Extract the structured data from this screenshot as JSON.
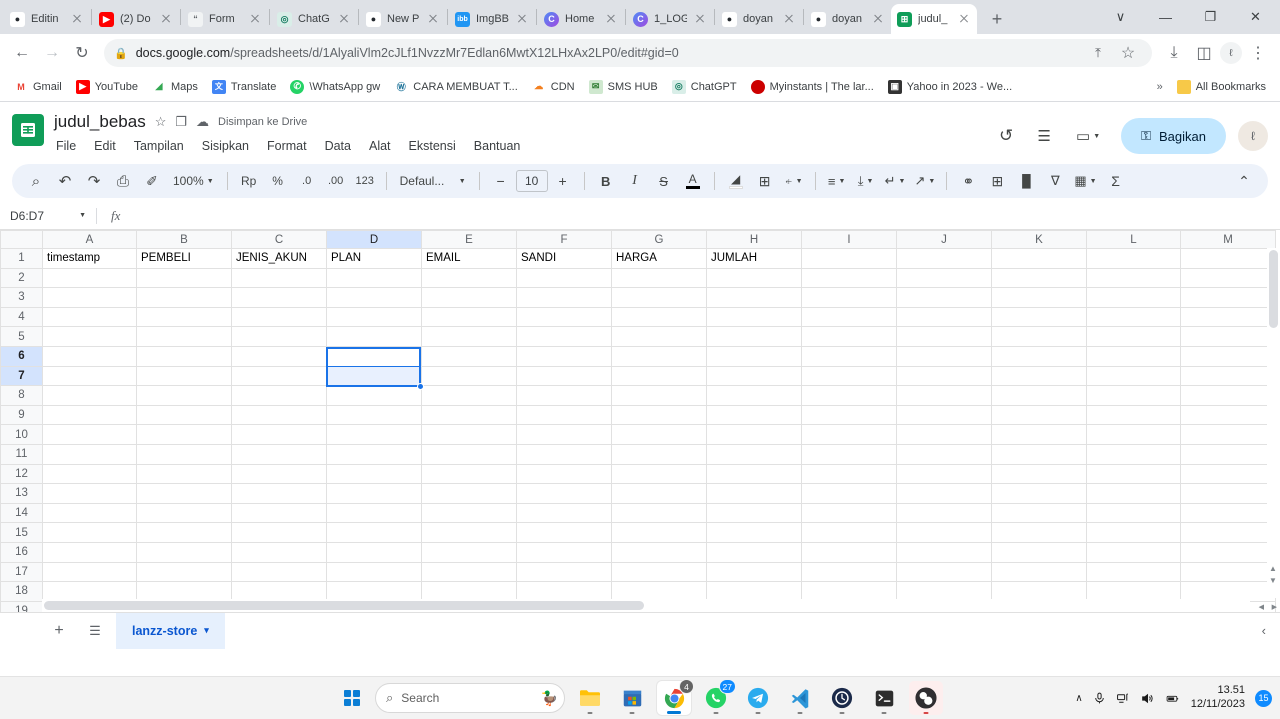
{
  "browser": {
    "tabs": [
      {
        "label": "Editin",
        "favicon": "github-icon",
        "fav_bg": "#ffffff",
        "fav_fg": "#24292e",
        "fav_text": "●",
        "active": false
      },
      {
        "label": "(2) Do",
        "favicon": "youtube-icon",
        "fav_bg": "#ff0000",
        "fav_fg": "#ffffff",
        "fav_text": "▶",
        "active": false
      },
      {
        "label": "Form",
        "favicon": "quote-icon",
        "fav_bg": "#f1f3f4",
        "fav_fg": "#5f6368",
        "fav_text": "“",
        "active": false
      },
      {
        "label": "ChatG",
        "favicon": "chatgpt-icon",
        "fav_bg": "#74aa9c",
        "fav_fg": "#ffffff",
        "fav_text": "◎",
        "active": false
      },
      {
        "label": "New P",
        "favicon": "github-icon",
        "fav_bg": "#ffffff",
        "fav_fg": "#24292e",
        "fav_text": "●",
        "active": false
      },
      {
        "label": "ImgBB",
        "favicon": "imgbb-icon",
        "fav_bg": "#2196f3",
        "fav_fg": "#ffffff",
        "fav_text": "ibb",
        "active": false
      },
      {
        "label": "Home",
        "favicon": "circle-gradient-icon",
        "fav_bg": "#7a3fd6",
        "fav_fg": "#ffffff",
        "fav_text": "C",
        "active": false
      },
      {
        "label": "1_LOG",
        "favicon": "circle-gradient-icon",
        "fav_bg": "#6a5acd",
        "fav_fg": "#ffffff",
        "fav_text": "C",
        "active": false
      },
      {
        "label": "doyan",
        "favicon": "github-icon",
        "fav_bg": "#ffffff",
        "fav_fg": "#24292e",
        "fav_text": "●",
        "active": false
      },
      {
        "label": "doyan",
        "favicon": "github-icon",
        "fav_bg": "#ffffff",
        "fav_fg": "#24292e",
        "fav_text": "●",
        "active": false
      },
      {
        "label": "judul_",
        "favicon": "sheets-icon",
        "fav_bg": "#0f9d58",
        "fav_fg": "#ffffff",
        "fav_text": "⊞",
        "active": true
      }
    ],
    "new_tab_label": "+",
    "window_controls": {
      "tab_search": "∨",
      "minimize": "—",
      "maximize": "❐",
      "close": "✕"
    },
    "nav": {
      "back": "←",
      "forward": "→",
      "reload": "↻"
    },
    "omnibox": {
      "lock_icon": "lock-icon",
      "host": "docs.google.com",
      "path": "/spreadsheets/d/1AlyaliVlm2cJLf1NvzzMr7Edlan6MwtX12LHxAx2LP0/edit#gid=0",
      "share_icon": "⤒",
      "star_icon": "☆",
      "download_icon": "⤓",
      "sidepanel_icon": "◫",
      "profile_icon": "ℓ",
      "menu_icon": "⋮"
    },
    "bookmarks": [
      {
        "label": "Gmail",
        "bg": "#ffffff",
        "fg": "#ea4335",
        "glyph": "M"
      },
      {
        "label": "YouTube",
        "bg": "#ff0000",
        "fg": "#ffffff",
        "glyph": "▶"
      },
      {
        "label": "Maps",
        "bg": "#ffffff",
        "fg": "#34a853",
        "glyph": "◢"
      },
      {
        "label": "Translate",
        "bg": "#4285f4",
        "fg": "#ffffff",
        "glyph": "文"
      },
      {
        "label": "\\WhatsApp gw",
        "bg": "#25d366",
        "fg": "#ffffff",
        "glyph": "✆"
      },
      {
        "label": "CARA MEMBUAT T...",
        "bg": "#ffffff",
        "fg": "#21759b",
        "glyph": "Ⓦ"
      },
      {
        "label": "CDN",
        "bg": "#ffffff",
        "fg": "#f38020",
        "glyph": "☁"
      },
      {
        "label": "SMS HUB",
        "bg": "#cfe8cf",
        "fg": "#2e7d32",
        "glyph": "✉"
      },
      {
        "label": "ChatGPT",
        "bg": "#ffffff",
        "fg": "#74aa9c",
        "glyph": "◎"
      },
      {
        "label": "Myinstants | The lar...",
        "bg": "#cc0000",
        "fg": "#ffffff",
        "glyph": "●"
      },
      {
        "label": "Yahoo in 2023 - We...",
        "bg": "#333333",
        "fg": "#ffffff",
        "glyph": "▣"
      }
    ],
    "overflow_label": "»",
    "all_bookmarks_label": "All Bookmarks",
    "all_bookmarks_icon_color": "#f7c948"
  },
  "sheets": {
    "app_icon": "sheets-icon",
    "title": "judul_bebas",
    "star_icon": "☆",
    "move_icon": "❐",
    "cloud_icon": "☁",
    "save_status": "Disimpan ke Drive",
    "menus": [
      "File",
      "Edit",
      "Tampilan",
      "Sisipkan",
      "Format",
      "Data",
      "Alat",
      "Ekstensi",
      "Bantuan"
    ],
    "header_actions": {
      "history_icon": "↺",
      "comment_icon": "☰",
      "meet_icon": "▭",
      "share_label": "Bagikan",
      "share_lock_icon": "⚿",
      "avatar_initial": "ℓ"
    },
    "toolbar": {
      "search": "⌕",
      "undo": "↶",
      "redo": "↷",
      "print": "⎙",
      "paint": "✐",
      "zoom_value": "100%",
      "currency": "Rp",
      "percent": "%",
      "decimal_decrease": ".0",
      "decimal_increase": ".00",
      "number_format": "123",
      "font_name": "Defaul...",
      "font_size_decrease": "−",
      "font_size": "10",
      "font_size_increase": "+",
      "bold": "B",
      "italic": "I",
      "strikethrough": "S",
      "text_color": "A",
      "fill_color": "◢",
      "borders": "⊞",
      "merge": "⍅",
      "halign": "≡",
      "valign": "⤓",
      "text_wrap": "↵",
      "text_rotation": "↗",
      "link": "⚭",
      "comment": "⊞",
      "chart": "█",
      "filter": "∇",
      "functions_misc": "▦",
      "sum": "Σ",
      "collapse": "⌃"
    },
    "formula_bar": {
      "name_box": "D6:D7",
      "fx_label": "fx",
      "formula_value": ""
    },
    "grid": {
      "columns": [
        "A",
        "B",
        "C",
        "D",
        "E",
        "F",
        "G",
        "H",
        "I",
        "J",
        "K",
        "L",
        "M"
      ],
      "selected_column": "D",
      "rows": [
        1,
        2,
        3,
        4,
        5,
        6,
        7,
        8,
        9,
        10,
        11,
        12,
        13,
        14,
        15,
        16,
        17,
        18,
        19
      ],
      "selected_rows": [
        6,
        7
      ],
      "row1_values": [
        "timestamp",
        "PEMBELI",
        "JENIS_AKUN",
        "PLAN",
        "EMAIL",
        "SANDI",
        "HARGA",
        "JUMLAH",
        "",
        "",
        "",
        "",
        ""
      ],
      "selection_range": "D6:D7",
      "active_cell": "D6"
    },
    "sheet_bar": {
      "add_sheet_icon": "+",
      "all_sheets_icon": "☰",
      "tabs": [
        {
          "label": "lanzz-store",
          "active": true,
          "menu_icon": "▾"
        }
      ],
      "expand_icon": "‹"
    }
  },
  "taskbar": {
    "start_label": "start-button",
    "search_placeholder": "Search",
    "search_icon": "⌕",
    "apps": [
      {
        "name": "file-explorer",
        "bg": "#ffc107",
        "glyph": "▱",
        "fg": "#f0a500",
        "badge": "",
        "running": true
      },
      {
        "name": "microsoft-store",
        "bg": "#2b5797",
        "glyph": "⊞",
        "fg": "#ffffff",
        "badge": "",
        "running": true
      },
      {
        "name": "google-chrome",
        "bg": "#ffffff",
        "glyph": "◉",
        "fg": "#4285f4",
        "badge": "4",
        "running": true
      },
      {
        "name": "whatsapp",
        "bg": "#25d366",
        "glyph": "✆",
        "fg": "#ffffff",
        "badge": "27",
        "running": true
      },
      {
        "name": "telegram",
        "bg": "#2aabee",
        "glyph": "➤",
        "fg": "#ffffff",
        "badge": "",
        "running": true
      },
      {
        "name": "vs-code",
        "bg": "#ffffff",
        "glyph": "✖",
        "fg": "#0078d4",
        "badge": "",
        "running": true
      },
      {
        "name": "clock-app",
        "bg": "#1b2a4a",
        "glyph": "◔",
        "fg": "#ffffff",
        "badge": "",
        "running": true
      },
      {
        "name": "terminal",
        "bg": "#2d2d2d",
        "glyph": "❯_",
        "fg": "#ffffff",
        "badge": "",
        "running": true
      },
      {
        "name": "obs-studio",
        "bg": "#f7e4e4",
        "glyph": "◕",
        "fg": "#302e31",
        "badge": "",
        "running": true
      }
    ],
    "tray": {
      "chevron": "∧",
      "mic_icon": "⚷",
      "network_icon": "▦",
      "volume_icon": "◁))",
      "battery_icon": "▭",
      "time": "13.51",
      "date": "12/11/2023",
      "notification_count": "15"
    }
  }
}
